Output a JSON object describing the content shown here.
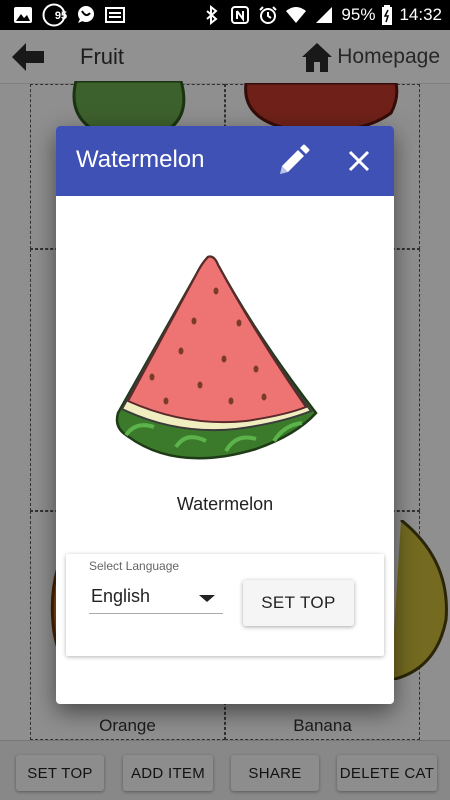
{
  "status_bar": {
    "battery": "95%",
    "time": "14:32",
    "badge_count": "95",
    "icons": [
      "image-icon",
      "badge-icon",
      "chat-icon",
      "sim-icon",
      "bluetooth-icon",
      "nfc-icon",
      "alarm-icon",
      "wifi-icon",
      "signal-icon",
      "battery-icon"
    ]
  },
  "app_bar": {
    "title": "Fruit",
    "home_label": "Homepage",
    "icons": [
      "back-arrow-icon",
      "home-icon"
    ]
  },
  "grid": {
    "labels": [
      "Orange",
      "Banana"
    ]
  },
  "toolbar": {
    "buttons": [
      "SET TOP",
      "ADD ITEM",
      "SHARE",
      "DELETE CAT"
    ]
  },
  "dialog": {
    "title": "Watermelon",
    "item_name": "Watermelon",
    "header_color": "#3f51b5",
    "icons": [
      "pencil-icon",
      "close-icon",
      "watermelon-image"
    ],
    "language": {
      "label": "Select Language",
      "value": "English"
    },
    "set_top_label": "SET TOP"
  }
}
